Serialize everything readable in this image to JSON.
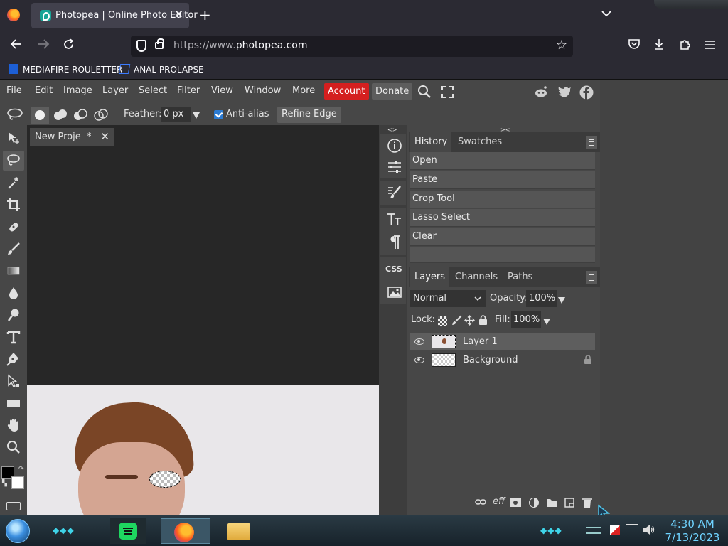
{
  "browser": {
    "tab_title": "Photopea | Online Photo Editor",
    "url_prefix": "https://www.",
    "url_domain": "photopea.com",
    "bookmarks": [
      "MEDIAFIRE ROULETTER",
      "ANAL PROLAPSE"
    ]
  },
  "menu": {
    "items": [
      "File",
      "Edit",
      "Image",
      "Layer",
      "Select",
      "Filter",
      "View",
      "Window",
      "More"
    ],
    "account": "Account",
    "donate": "Donate",
    "account_color": "#d41f1f"
  },
  "options": {
    "feather_label": "Feather:",
    "feather_value": "0 px",
    "antialias_label": "Anti-alias",
    "refine_edge": "Refine Edge"
  },
  "document": {
    "tab_title": "New Proje",
    "modified_mark": "*"
  },
  "strip": {
    "css_label": "CSS"
  },
  "history": {
    "tabs": [
      "History",
      "Swatches"
    ],
    "items": [
      "Open",
      "Paste",
      "Crop Tool",
      "Lasso Select",
      "Clear"
    ]
  },
  "layers": {
    "tabs": [
      "Layers",
      "Channels",
      "Paths"
    ],
    "blend_mode": "Normal",
    "opacity_label": "Opacity:",
    "opacity_value": "100%",
    "lock_label": "Lock:",
    "fill_label": "Fill:",
    "fill_value": "100%",
    "rows": [
      {
        "name": "Layer 1",
        "selected": true,
        "locked": false
      },
      {
        "name": "Background",
        "selected": false,
        "locked": true
      }
    ],
    "footer_fx": "eff"
  },
  "taskbar": {
    "time": "4:30 AM",
    "date": "7/13/2023"
  }
}
